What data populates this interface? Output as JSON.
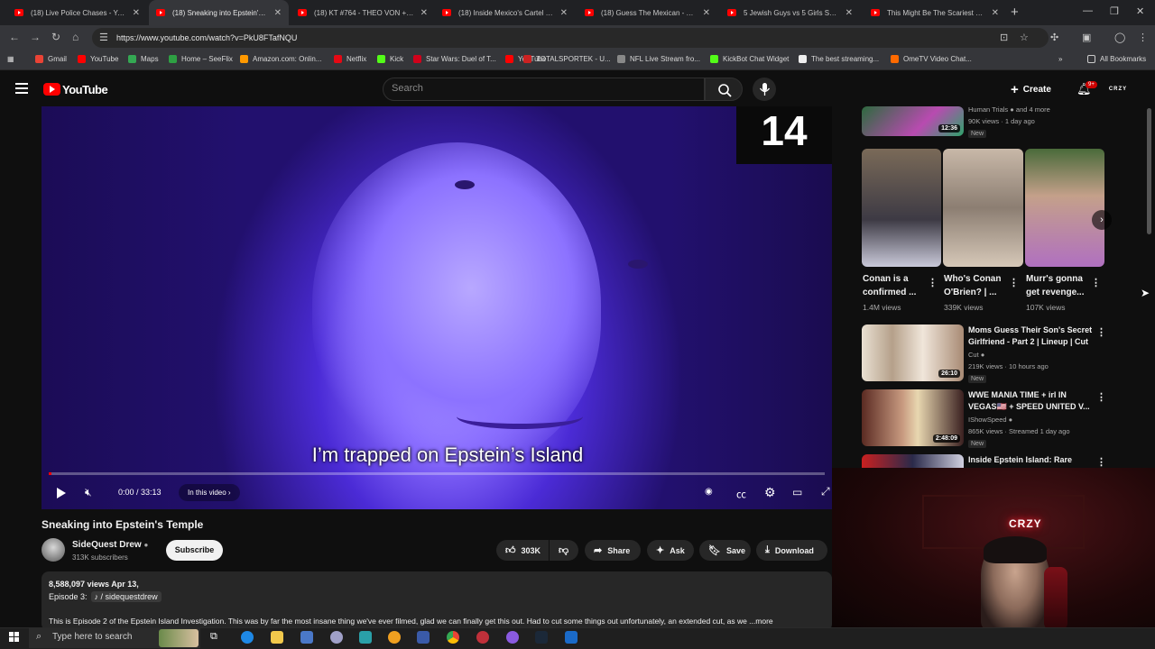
{
  "browser": {
    "tabs": [
      {
        "title": "(18) Live Police Chases - YouTube"
      },
      {
        "title": "(18) Sneaking into Epstein's Temple"
      },
      {
        "title": "(18) KT #764 - THEO VON + JE..."
      },
      {
        "title": "(18) Inside Mexico's Cartel Civil..."
      },
      {
        "title": "(18) Guess The Mexican - YouTube"
      },
      {
        "title": "5 Jewish Guys vs 5 Girls Speed..."
      },
      {
        "title": "This Might Be The Scariest Gam..."
      }
    ],
    "url": "https://www.youtube.com/watch?v=PkU8FTafNQU",
    "bookmarks": [
      {
        "label": "Gmail",
        "color": "#ea4335"
      },
      {
        "label": "YouTube",
        "color": "#ff0000"
      },
      {
        "label": "Maps",
        "color": "#34a853"
      },
      {
        "label": "Home – SeeFlix",
        "color": "#2ea043"
      },
      {
        "label": "Amazon.com: Onlin...",
        "color": "#ff9900"
      },
      {
        "label": "Netflix",
        "color": "#e50914"
      },
      {
        "label": "Kick",
        "color": "#53fc18"
      },
      {
        "label": "Star Wars: Duel of T...",
        "color": "#d0021b"
      },
      {
        "label": "YouTube",
        "color": "#ff0000"
      },
      {
        "label": "TOTALSPORTEK - U...",
        "color": "#cc2222"
      },
      {
        "label": "NFL Live Stream fro...",
        "color": "#888888"
      },
      {
        "label": "KickBot Chat Widget",
        "color": "#53fc18"
      },
      {
        "label": "The best streaming...",
        "color": "#eeeeee"
      },
      {
        "label": "OmeTV Video Chat...",
        "color": "#ff6a00"
      }
    ],
    "all_bookmarks": "All Bookmarks"
  },
  "header": {
    "logo_text": "YouTube",
    "search_placeholder": "Search",
    "create_label": "Create",
    "notif_count": "9+",
    "avatar_text": "CRZY"
  },
  "player": {
    "overlay_number": "14",
    "caption": "I’m trapped on Epstein’s Island",
    "time": "0:00 / 33:13",
    "progress": 0.003,
    "in_video_label": "In this video"
  },
  "video": {
    "title": "Sneaking into Epstein's Temple",
    "channel": "SideQuest Drew",
    "subscribers": "313K subscribers",
    "subscribe_label": "Subscribe",
    "likes": "303K",
    "share_label": "Share",
    "ask_label": "Ask",
    "save_label": "Save",
    "download_label": "Download",
    "stats": "8,588,097 views  Apr 13,",
    "episode": "Episode 3:",
    "episode_tag": "/ sidequestdrew",
    "description": "This is Episode 2 of the Epstein Island Investigation. This was by far the most insane thing we've ever filmed, glad we can finally get this out. Had to cut some things out unfortunately, an extended cut, as we ...more"
  },
  "sidebar": {
    "top_item": {
      "channel": "Human Trials",
      "channel_extra": "and 4 more",
      "meta": "90K views · 1 day ago",
      "badge": "New",
      "duration": "12:36"
    },
    "shorts": [
      {
        "title_line1": "Conan is a",
        "title_line2": "confirmed ...",
        "views": "1.4M views"
      },
      {
        "title_line1": "Who's Conan",
        "title_line2": "O'Brien? | ...",
        "views": "339K views"
      },
      {
        "title_line1": "Murr's gonna",
        "title_line2": "get revenge...",
        "views": "107K views"
      }
    ],
    "videos": [
      {
        "title_line1": "Moms Guess Their Son's Secret",
        "title_line2": "Girlfriend - Part 2 | Lineup | Cut",
        "channel": "Cut",
        "meta": "219K views · 10 hours ago",
        "badge": "New",
        "duration": "26:10"
      },
      {
        "title_line1": "WWE MANIA TIME + irl IN",
        "title_line2": "VEGAS🇺🇸 + SPEED UNITED V...",
        "channel": "IShowSpeed",
        "meta": "865K views · Streamed 1 day ago",
        "badge": "New",
        "duration": "2:48:09"
      },
      {
        "title_line1": "Inside Epstein Island: Rare",
        "title_line2": "",
        "channel": "",
        "meta": "",
        "badge": "",
        "duration": ""
      }
    ]
  },
  "webcam": {
    "neon_sign": "CRZY"
  },
  "taskbar": {
    "search_text": "Type here to search"
  }
}
